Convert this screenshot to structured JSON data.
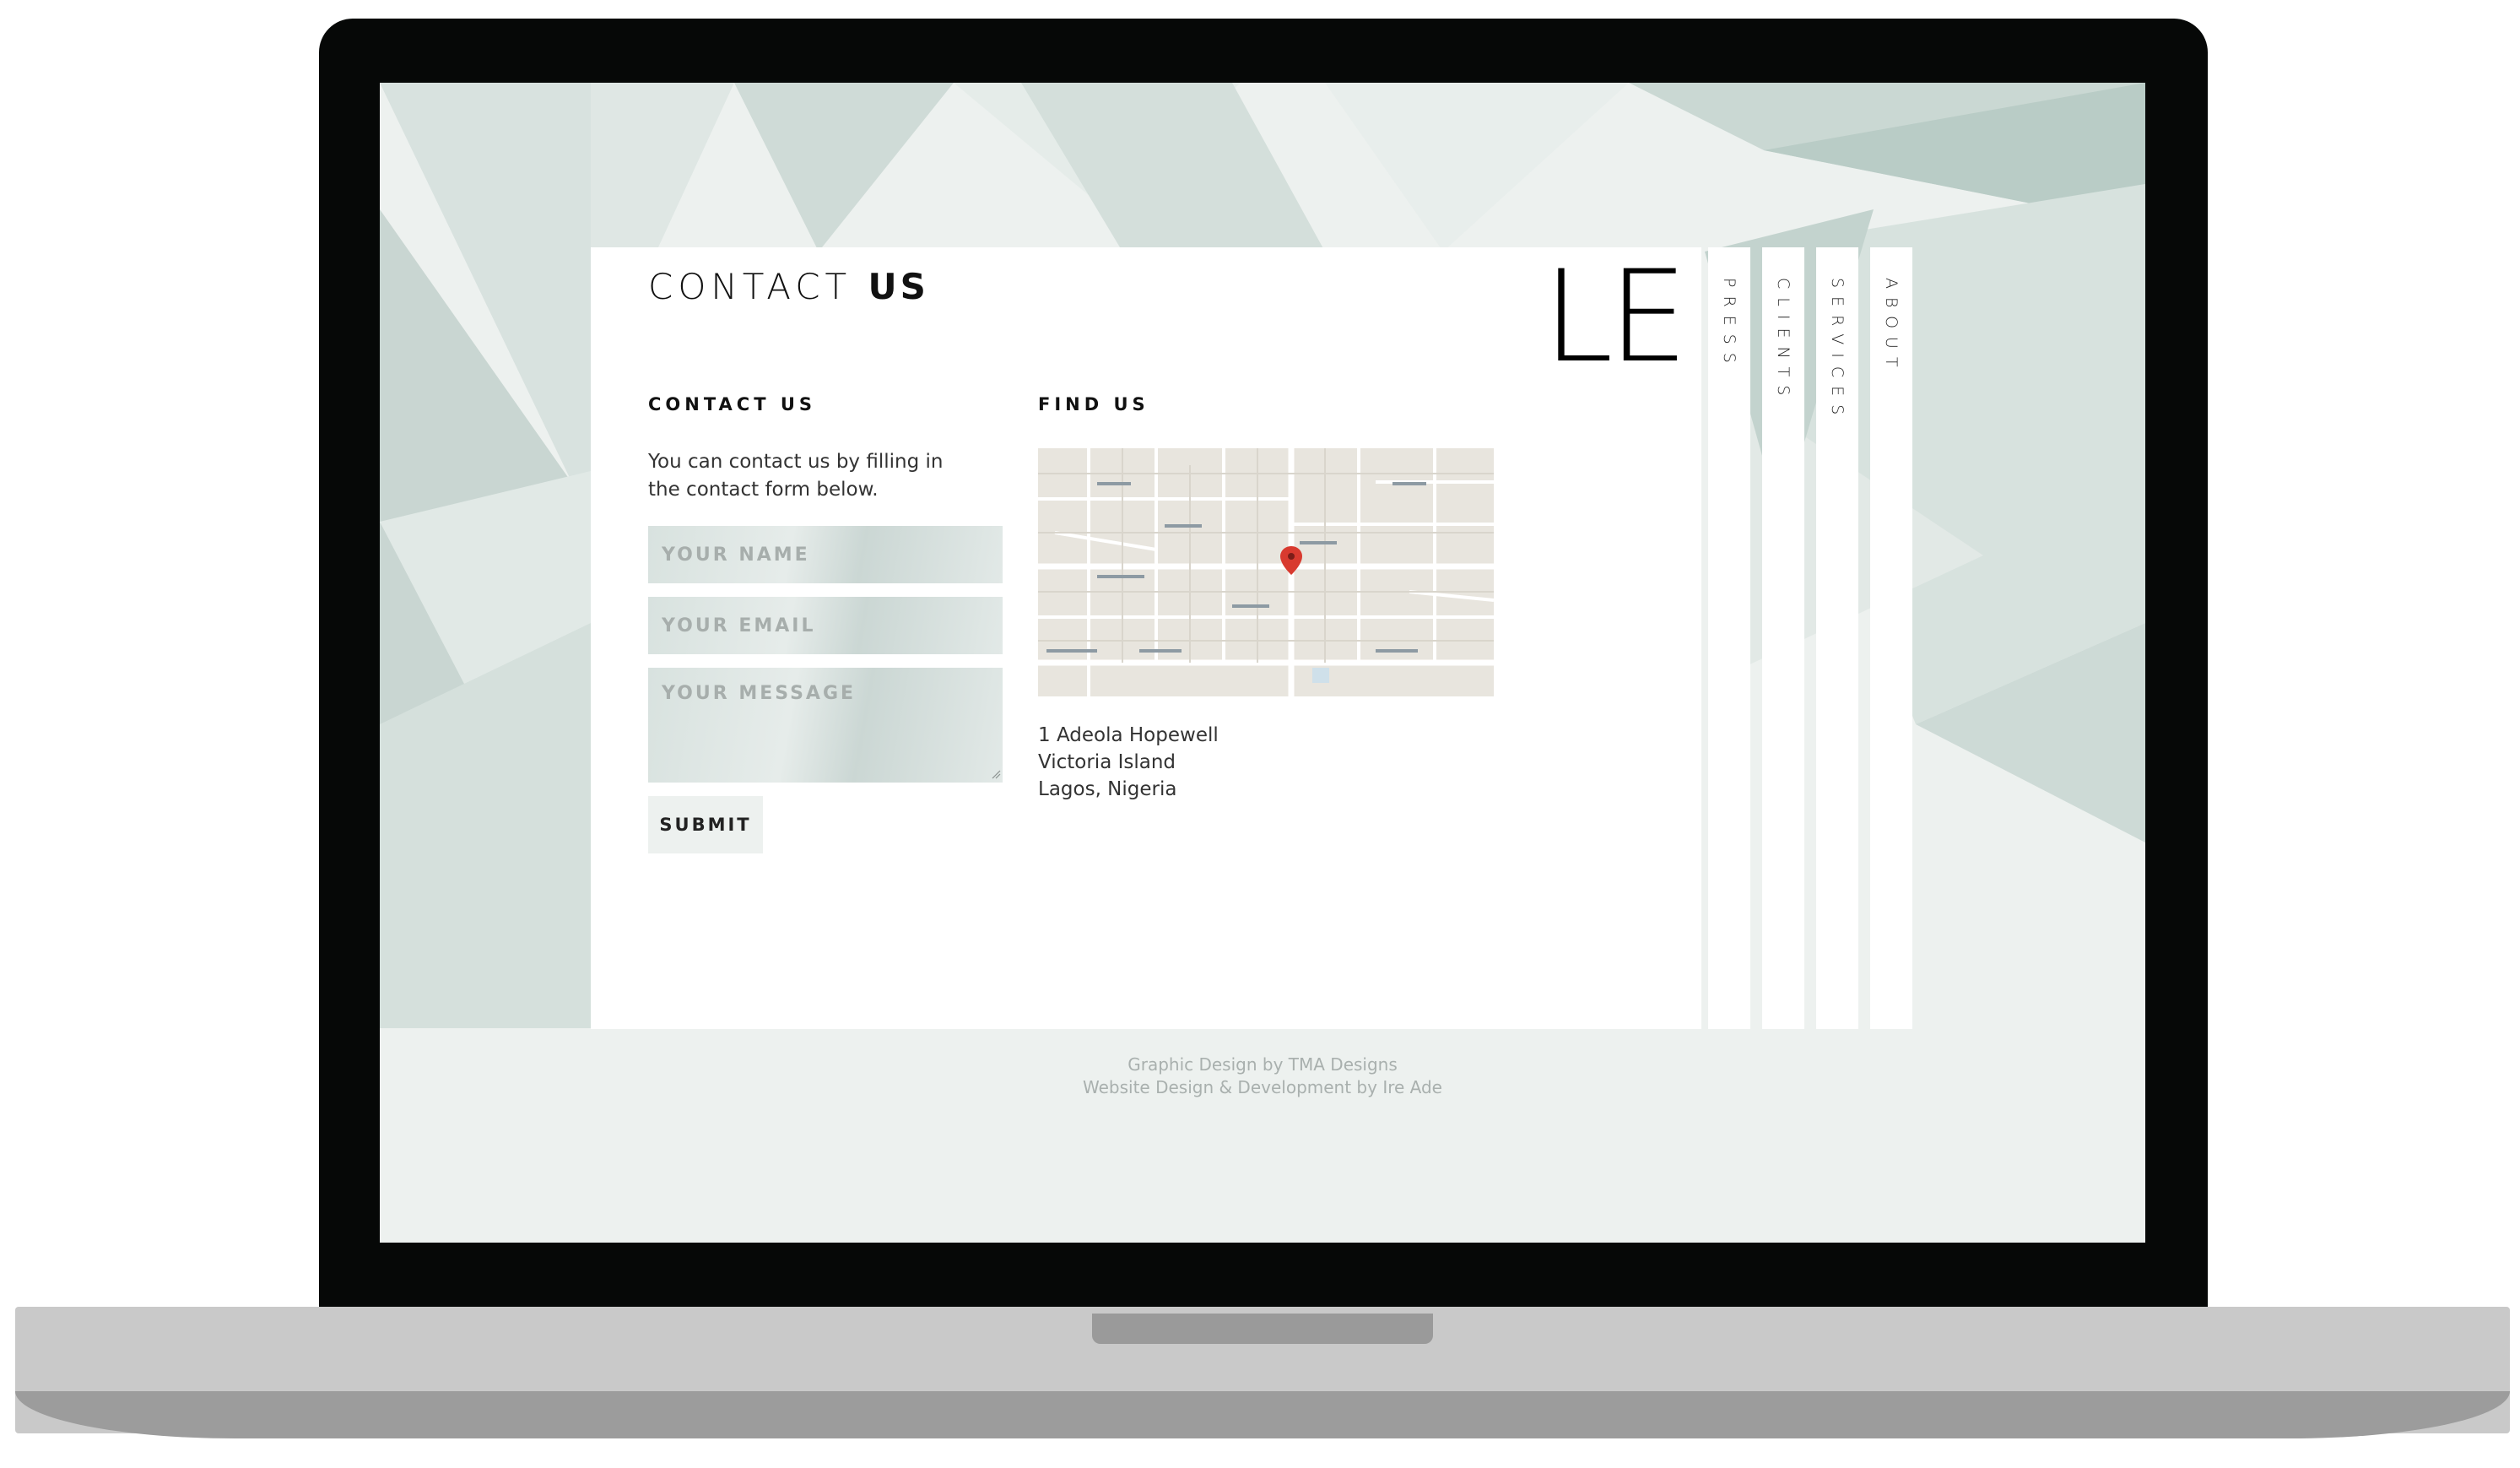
{
  "header": {
    "title_light": "CONTACT",
    "title_bold": "US",
    "logo": "LE"
  },
  "nav": {
    "items": [
      {
        "label": "PRESS"
      },
      {
        "label": "CLIENTS"
      },
      {
        "label": "SERVICES"
      },
      {
        "label": "ABOUT"
      }
    ]
  },
  "contact": {
    "heading": "CONTACT US",
    "intro": "You can contact us by filling in the contact form below.",
    "name_placeholder": "YOUR NAME",
    "email_placeholder": "YOUR EMAIL",
    "message_placeholder": "YOUR MESSAGE",
    "submit_label": "SUBMIT"
  },
  "find": {
    "heading": "FIND US",
    "map_icon": "location-pin-icon",
    "address": [
      "1 Adeola Hopewell",
      "Victoria Island",
      "Lagos, Nigeria"
    ]
  },
  "footer": {
    "line1": "Graphic Design by TMA Designs",
    "line2": "Website Design & Development by Ire Ade"
  },
  "colors": {
    "background": "#edf1ef",
    "panel": "#ffffff",
    "field": "#dbe4e1",
    "text": "#111111",
    "pin": "#d83a2f"
  }
}
